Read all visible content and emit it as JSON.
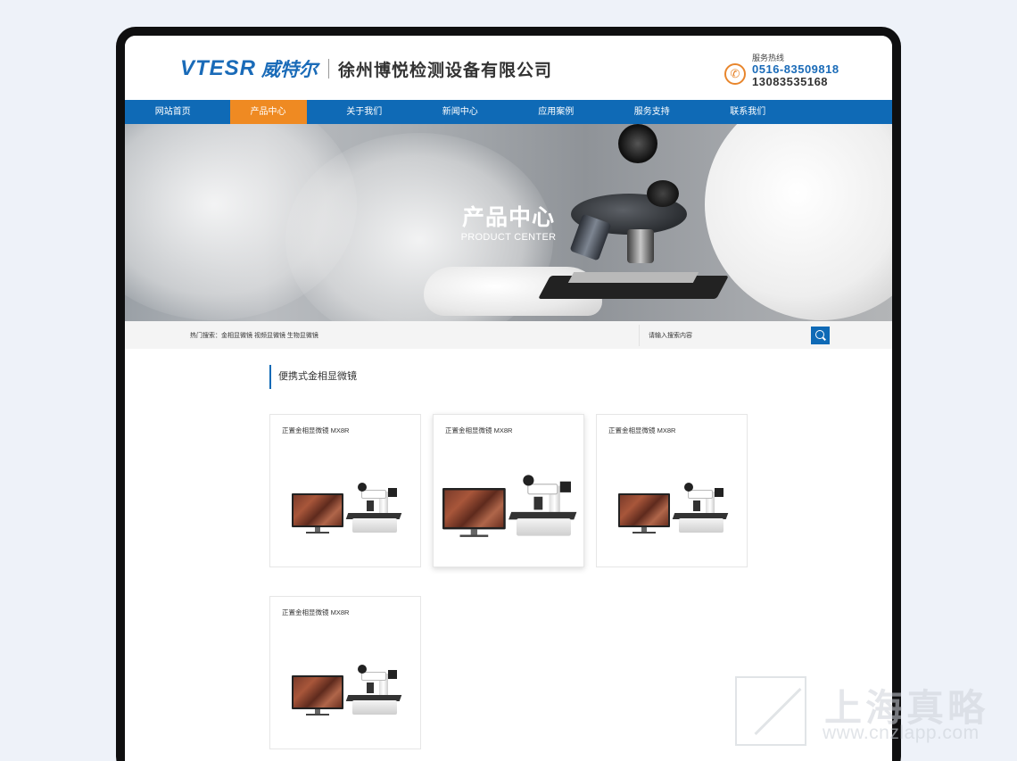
{
  "header": {
    "logo_en": "VTESR",
    "logo_cn": "威特尔",
    "company": "徐州博悦检测设备有限公司",
    "hotline_label": "服务热线",
    "phone1": "0516-83509818",
    "phone2": "13083535168"
  },
  "nav": {
    "items": [
      "网站首页",
      "产品中心",
      "关于我们",
      "新闻中心",
      "应用案例",
      "服务支持",
      "联系我们"
    ],
    "active": "产品中心"
  },
  "banner": {
    "title": "产品中心",
    "subtitle": "PRODUCT CENTER"
  },
  "search": {
    "hot_label": "热门搜索：",
    "hot_terms": "金相显微镜 视频显微镜 生物显微镜",
    "placeholder": "请输入搜索内容"
  },
  "section": {
    "title": "便携式金相显微镜"
  },
  "products": [
    {
      "title": "正置金相显微镜 MX8R"
    },
    {
      "title": "正置金相显微镜 MX8R"
    },
    {
      "title": "正置金相显微镜 MX8R"
    },
    {
      "title": "正置金相显微镜 MX8R"
    }
  ],
  "watermark": {
    "cn": "上海真略",
    "url": "www.cnzlapp.com"
  },
  "colors": {
    "brand_blue": "#0f6ab6",
    "accent_orange": "#ef8a22"
  }
}
